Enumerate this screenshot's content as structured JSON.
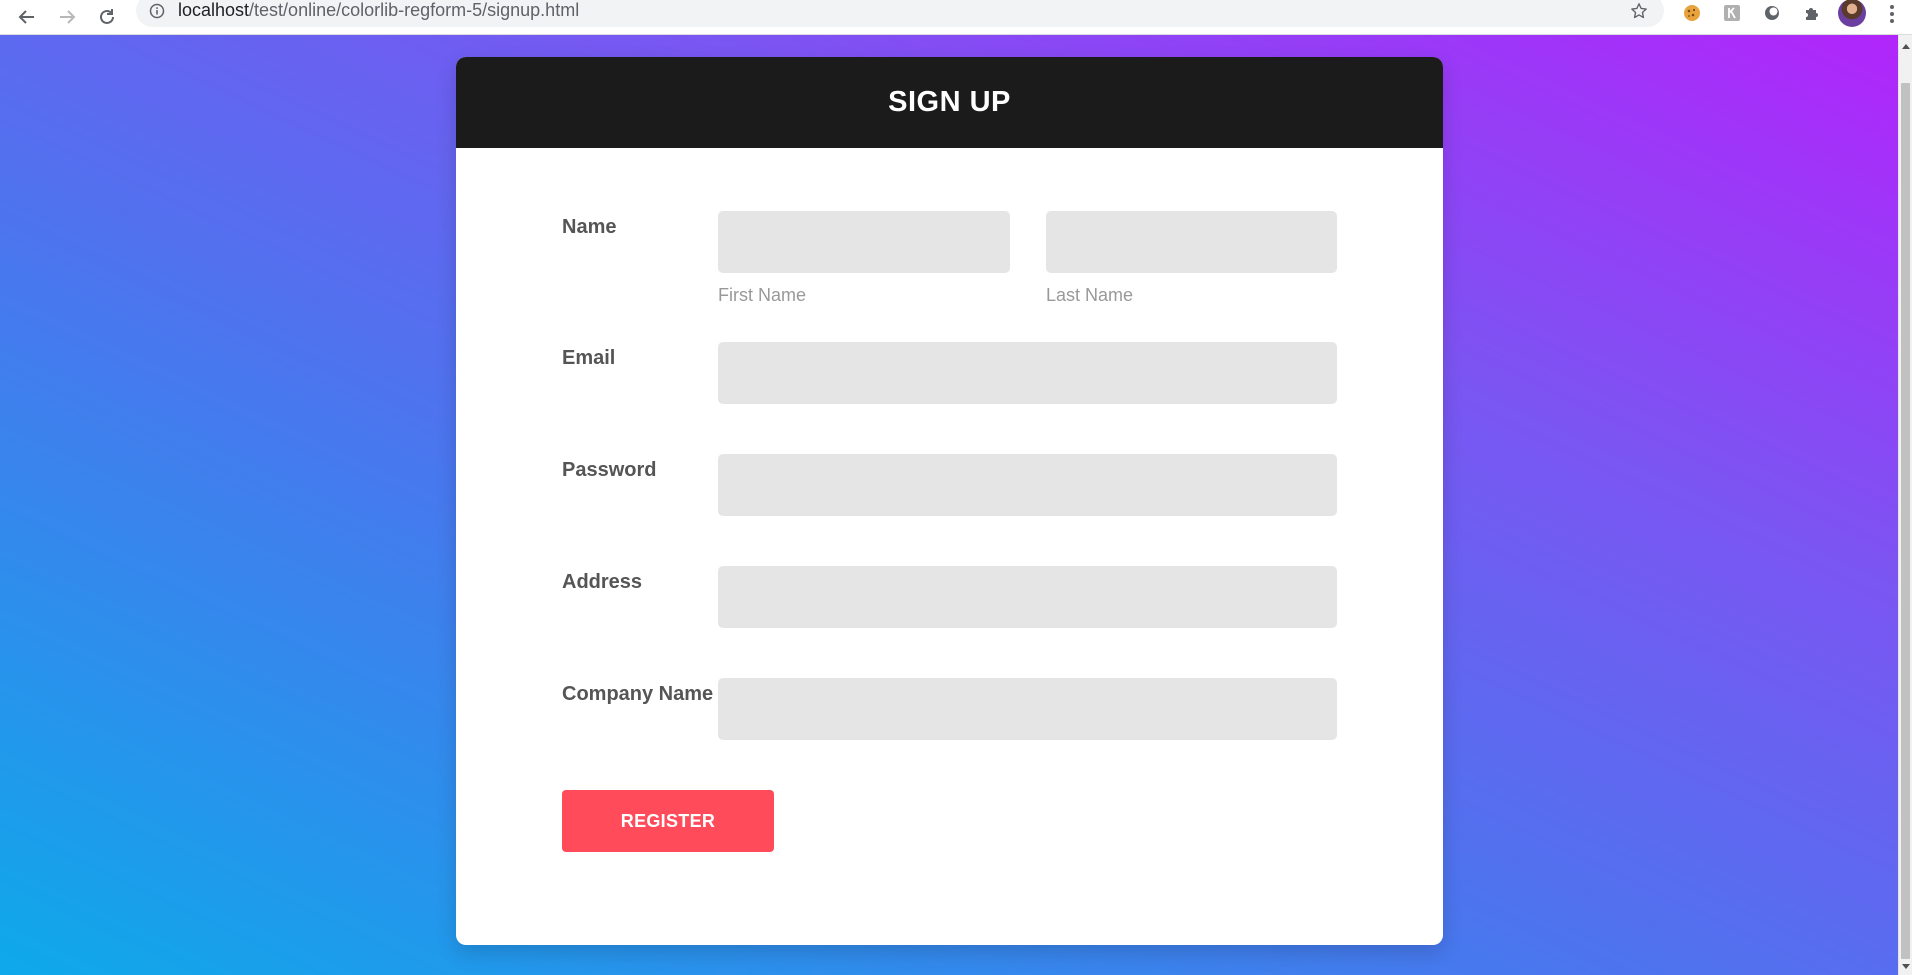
{
  "browser": {
    "url_host": "localhost",
    "url_path": "/test/online/colorlib-regform-5/signup.html"
  },
  "form": {
    "title": "SIGN UP",
    "name_label": "Name",
    "first_name_caption": "First Name",
    "last_name_caption": "Last Name",
    "first_name_value": "",
    "last_name_value": "",
    "email_label": "Email",
    "email_value": "",
    "password_label": "Password",
    "password_value": "",
    "address_label": "Address",
    "address_value": "",
    "company_label": "Company Name",
    "company_value": "",
    "register_label": "REGISTER"
  },
  "colors": {
    "header_bg": "#1b1b1b",
    "button_bg": "#ff4b5a",
    "field_bg": "#e5e5e5",
    "gradient_start": "#b125fb",
    "gradient_end": "#0ea9ea"
  },
  "icons": {
    "back": "arrow-left-icon",
    "forward": "arrow-right-icon",
    "reload": "reload-icon",
    "info": "info-icon",
    "bookmark": "star-icon",
    "extensions": "puzzle-icon",
    "menu": "kebab-icon"
  }
}
